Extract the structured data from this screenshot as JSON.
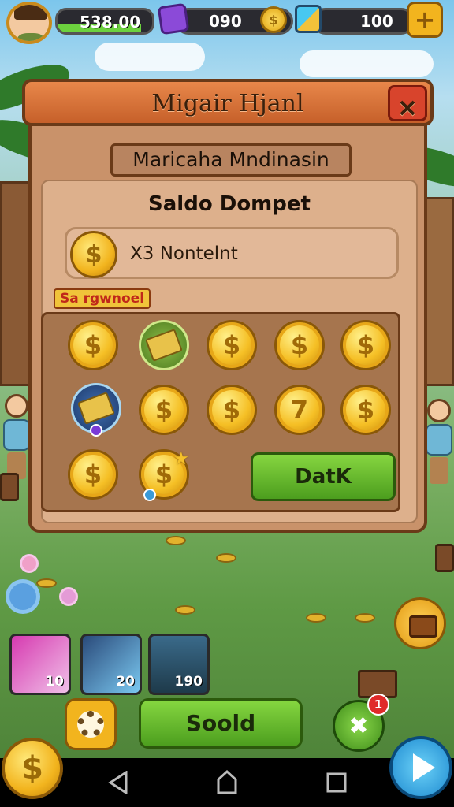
{
  "hud": {
    "xp_value": "538.00",
    "gems_value": "090",
    "cubes_value": "100",
    "plus_label": "+",
    "coin_symbol": "$"
  },
  "dialog": {
    "title": "Migair Hjanl",
    "close_label": "✕",
    "subtitle": "Maricaha Mndinasin",
    "section_title": "Saldo Dompet",
    "balance_text": "X3 Nontelnt",
    "grid_label": "Sa rgwnoel",
    "action_button": "DatK",
    "grid_items": [
      {
        "kind": "coin",
        "label": "$"
      },
      {
        "kind": "pack",
        "label": ""
      },
      {
        "kind": "coin",
        "label": "$"
      },
      {
        "kind": "coin",
        "label": "$"
      },
      {
        "kind": "coin",
        "label": "$"
      },
      {
        "kind": "pack",
        "label": ""
      },
      {
        "kind": "coin",
        "label": "$"
      },
      {
        "kind": "coin",
        "label": "$"
      },
      {
        "kind": "coin",
        "label": "7"
      },
      {
        "kind": "coin",
        "label": "$"
      },
      {
        "kind": "coin",
        "label": "$"
      },
      {
        "kind": "coin",
        "label": "$"
      }
    ]
  },
  "bottom": {
    "cards": [
      {
        "name": "ticket",
        "count": "10"
      },
      {
        "name": "crystal-pack",
        "count": "20"
      },
      {
        "name": "character",
        "count": "190"
      }
    ],
    "main_button": "Soold",
    "tools_badge": "1",
    "coin_symbol": "$"
  },
  "colors": {
    "accent_orange": "#d6703a",
    "button_green": "#5cb82a",
    "coin_gold": "#f5bf25",
    "close_red": "#d8442c"
  },
  "icons": [
    "avatar",
    "gem-icon",
    "coin-icon",
    "cube-icon",
    "plus-icon",
    "close-icon",
    "chest-icon",
    "gear-icon",
    "tools-icon",
    "play-icon",
    "nav-back-icon",
    "nav-home-icon",
    "nav-recents-icon"
  ]
}
